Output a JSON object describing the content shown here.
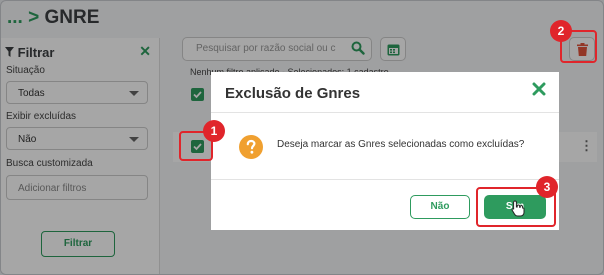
{
  "header": {
    "breadcrumb_prefix": "...",
    "breadcrumb_sep": ">",
    "title": "GNRE"
  },
  "sidebar": {
    "title": "Filtrar",
    "situacao_label": "Situação",
    "situacao_value": "Todas",
    "excluidas_label": "Exibir excluídas",
    "excluidas_value": "Não",
    "busca_label": "Busca customizada",
    "busca_placeholder": "Adicionar filtros",
    "filtrar_button": "Filtrar"
  },
  "main": {
    "search_placeholder": "Pesquisar por razão social ou c",
    "filter_status": "Nenhum filtro aplicado - Selecionados: 1 cadastro"
  },
  "modal": {
    "title": "Exclusão de Gnres",
    "message": "Deseja marcar as Gnres selecionadas como excluídas?",
    "no_button": "Não",
    "yes_button": "Sim"
  },
  "annotations": {
    "step1": "1",
    "step2": "2",
    "step3": "3"
  },
  "colors": {
    "accent": "#2e9b5e",
    "highlight": "#e0252b",
    "warning": "#f0a030",
    "danger": "#e2533b"
  },
  "icons": [
    "filter-icon",
    "close-icon",
    "chevron-down-icon",
    "search-icon",
    "calendar-icon",
    "trash-icon",
    "checkbox-checked-icon",
    "kebab-menu-icon",
    "question-icon",
    "hand-cursor-icon"
  ]
}
